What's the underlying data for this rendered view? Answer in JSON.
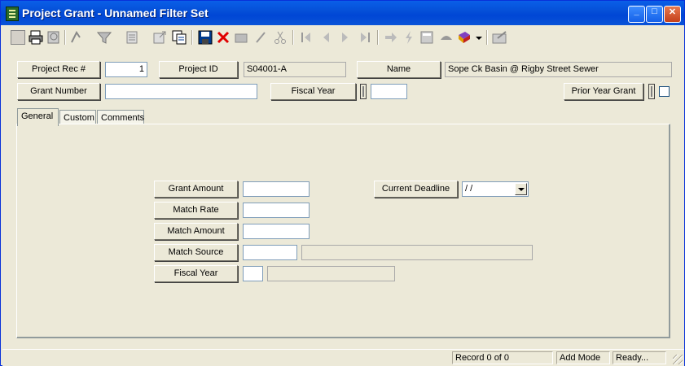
{
  "window": {
    "title": "Project Grant - Unnamed Filter Set"
  },
  "title_buttons": {
    "minimize": "_",
    "maximize": "□",
    "close": "✕"
  },
  "toolbar": {
    "icons": [
      "form-view-icon",
      "print-icon",
      "print-preview-icon",
      "query-icon",
      "filter-icon",
      "report-icon",
      "export-icon",
      "copy-icon",
      "save-icon",
      "delete-icon",
      "edit-icon",
      "pen-icon",
      "cut-icon",
      "first-record-icon",
      "prev-record-icon",
      "next-record-icon",
      "last-record-icon",
      "goto-icon",
      "lightning-icon",
      "calc-icon",
      "eraser-icon",
      "book-icon",
      "exit-icon"
    ]
  },
  "header": {
    "project_rec_label": "Project Rec #",
    "project_rec_value": "1",
    "project_id_label": "Project ID",
    "project_id_value": "S04001-A",
    "name_label": "Name",
    "name_value": "Sope Ck Basin @ Rigby Street Sewer",
    "grant_number_label": "Grant Number",
    "grant_number_value": "",
    "fiscal_year_label": "Fiscal Year",
    "fiscal_year_value": "",
    "prior_year_grant_label": "Prior Year Grant"
  },
  "tabs": [
    {
      "label": "General"
    },
    {
      "label": "Custom"
    },
    {
      "label": "Comments"
    }
  ],
  "general": {
    "grant_amount_label": "Grant Amount",
    "grant_amount_value": "",
    "match_rate_label": "Match Rate",
    "match_rate_value": "",
    "match_amount_label": "Match Amount",
    "match_amount_value": "",
    "match_source_label": "Match Source",
    "match_source_code": "",
    "match_source_desc": "",
    "fiscal_year_label": "Fiscal Year",
    "fiscal_year_code": "",
    "fiscal_year_desc": "",
    "current_deadline_label": "Current Deadline",
    "current_deadline_value": " /  /"
  },
  "status": {
    "record": "Record 0 of 0",
    "mode": "Add Mode",
    "state": "Ready..."
  },
  "colors": {
    "titlebar": "#0A5FE8",
    "face": "#ECE9D8",
    "delete": "#E00000",
    "save": "#003A8C"
  }
}
